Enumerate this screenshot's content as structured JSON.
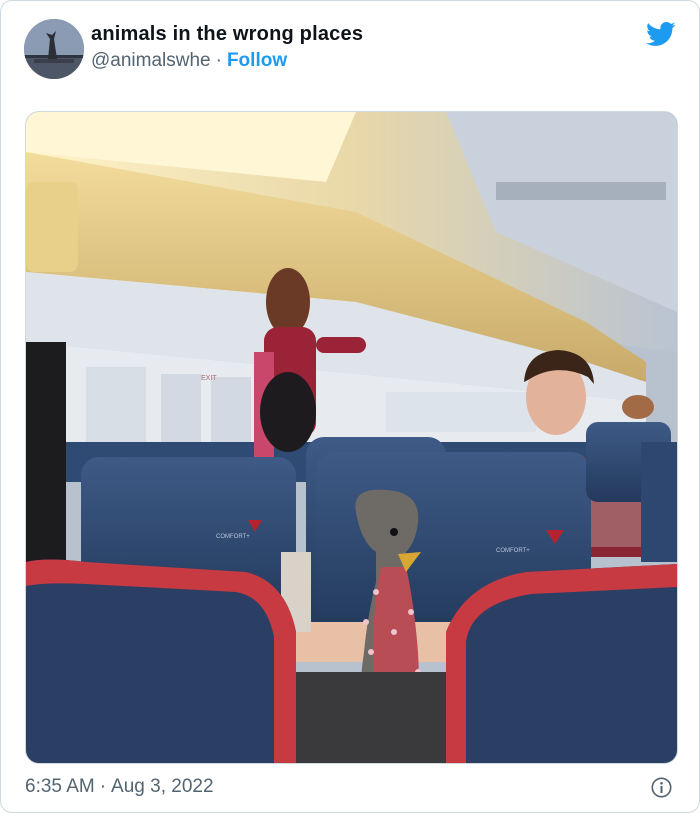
{
  "tweet": {
    "display_name": "animals in the wrong places",
    "handle": "@animalswhe",
    "separator": "·",
    "follow_label": "Follow",
    "time": "6:35 AM",
    "date": "Aug 3, 2022"
  },
  "media": {
    "seat_text_left": "COMFORT+",
    "seat_text_right": "COMFORT+",
    "exit_sign": "EXIT"
  },
  "colors": {
    "brand": "#1d9bf0",
    "text_primary": "#0f1419",
    "text_secondary": "#536471",
    "border": "#cfd9de"
  },
  "icons": {
    "brand_icon": "twitter-bird-icon",
    "info_icon": "info-icon"
  }
}
